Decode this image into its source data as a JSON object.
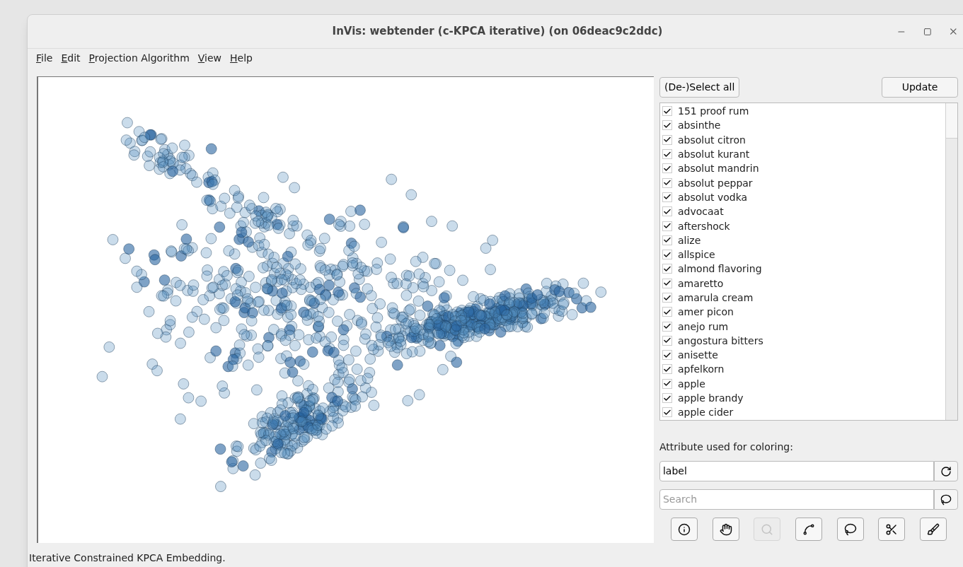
{
  "window": {
    "title": "InVis: webtender (c-KPCA iterative) (on 06deac9c2ddc)"
  },
  "menu": [
    {
      "label": "File"
    },
    {
      "label": "Edit"
    },
    {
      "label": "Projection Algorithm"
    },
    {
      "label": "View"
    },
    {
      "label": "Help"
    }
  ],
  "select_all_button": {
    "label": "(De-)Select all"
  },
  "update_button": {
    "label": "Update"
  },
  "items": [
    {
      "label": "151 proof rum",
      "checked": true
    },
    {
      "label": "absinthe",
      "checked": true
    },
    {
      "label": "absolut citron",
      "checked": true
    },
    {
      "label": "absolut kurant",
      "checked": true
    },
    {
      "label": "absolut mandrin",
      "checked": true
    },
    {
      "label": "absolut peppar",
      "checked": true
    },
    {
      "label": "absolut vodka",
      "checked": true
    },
    {
      "label": "advocaat",
      "checked": true
    },
    {
      "label": "aftershock",
      "checked": true
    },
    {
      "label": "alize",
      "checked": true
    },
    {
      "label": "allspice",
      "checked": true
    },
    {
      "label": "almond flavoring",
      "checked": true
    },
    {
      "label": "amaretto",
      "checked": true
    },
    {
      "label": "amarula cream",
      "checked": true
    },
    {
      "label": "amer picon",
      "checked": true
    },
    {
      "label": "anejo rum",
      "checked": true
    },
    {
      "label": "angostura bitters",
      "checked": true
    },
    {
      "label": "anisette",
      "checked": true
    },
    {
      "label": "apfelkorn",
      "checked": true
    },
    {
      "label": "apple",
      "checked": true
    },
    {
      "label": "apple brandy",
      "checked": true
    },
    {
      "label": "apple cider",
      "checked": true
    }
  ],
  "coloring": {
    "label": "Attribute used for coloring:",
    "value": "label"
  },
  "search": {
    "placeholder": "Search"
  },
  "tools": [
    {
      "kind": "info",
      "disabled": false
    },
    {
      "kind": "hand",
      "disabled": false
    },
    {
      "kind": "magnifier",
      "disabled": true
    },
    {
      "kind": "curve",
      "disabled": false
    },
    {
      "kind": "lasso",
      "disabled": false
    },
    {
      "kind": "cut",
      "disabled": false
    },
    {
      "kind": "brush",
      "disabled": false
    }
  ],
  "status_bar": "Iterative Constrained KPCA Embedding."
}
